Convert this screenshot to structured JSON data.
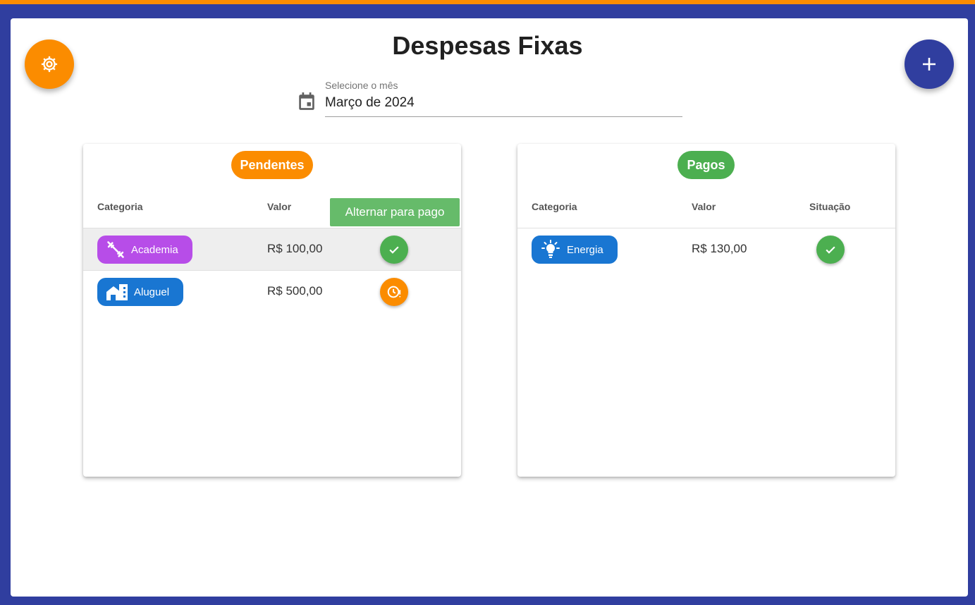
{
  "page": {
    "title": "Despesas Fixas"
  },
  "icons": {
    "settings": "gear-icon",
    "add": "plus-icon",
    "calendar": "calendar-icon"
  },
  "colors": {
    "orange": "#fb8c00",
    "indigo": "#303e9f",
    "green": "#4caf50",
    "purple": "#b74de8",
    "blue": "#1976d2"
  },
  "month_picker": {
    "label": "Selecione o mês",
    "value": "Março de 2024"
  },
  "columns": {
    "category": "Categoria",
    "value": "Valor",
    "status": "Situação"
  },
  "pending": {
    "header": "Pendentes",
    "tooltip": "Alternar para pago",
    "rows": [
      {
        "category": "Academia",
        "icon": "dumbbell-icon",
        "value": "R$ 100,00",
        "status": "check"
      },
      {
        "category": "Aluguel",
        "icon": "house-icon",
        "value": "R$ 500,00",
        "status": "clock-alert"
      }
    ]
  },
  "paid": {
    "header": "Pagos",
    "rows": [
      {
        "category": "Energia",
        "icon": "lightbulb-icon",
        "value": "R$ 130,00",
        "status": "check"
      }
    ]
  }
}
